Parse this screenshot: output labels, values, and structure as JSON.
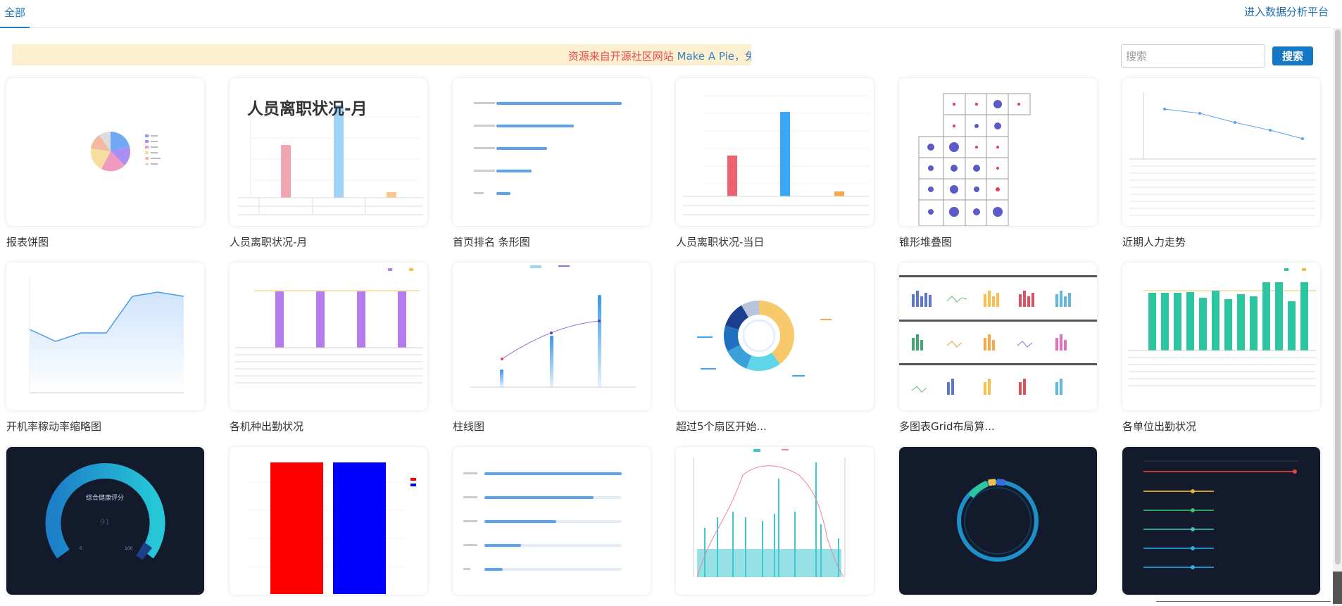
{
  "header": {
    "tab_all": "全部",
    "enter_link": "进入数据分析平台"
  },
  "notice": {
    "text": "资源来自开源社区网站 ",
    "link": "Make A Pie，免"
  },
  "search": {
    "placeholder": "搜索",
    "button": "搜索"
  },
  "cards": [
    {
      "title": "报表饼图"
    },
    {
      "title": "人员离职状况-月",
      "overlay": "人员离职状况-月"
    },
    {
      "title": "首页排名 条形图"
    },
    {
      "title": "人员离职状况-当日"
    },
    {
      "title": "锥形堆叠图"
    },
    {
      "title": "近期人力走势"
    },
    {
      "title": "开机率稼动率缩略图"
    },
    {
      "title": "各机种出勤状况"
    },
    {
      "title": "柱线图"
    },
    {
      "title": "超过5个扇区开始..."
    },
    {
      "title": "多图表Grid布局算..."
    },
    {
      "title": "各单位出勤状况"
    },
    {
      "title": ""
    },
    {
      "title": ""
    },
    {
      "title": ""
    },
    {
      "title": ""
    },
    {
      "title": ""
    },
    {
      "title": ""
    }
  ],
  "thumb": {
    "gauge_title": "综合健康评分",
    "gauge_value": "91",
    "gauge_min": "0",
    "gauge_max": "100",
    "colors": {
      "accent": "#1677c5",
      "blue_bar": "#3aa7f5",
      "pink_bar": "#f0a7b2",
      "purple_bar": "#b57cf0",
      "teal_bar": "#2cc7a0",
      "red": "#ff0000",
      "blue": "#0000ff",
      "dark_bg": "#121a2c"
    }
  }
}
